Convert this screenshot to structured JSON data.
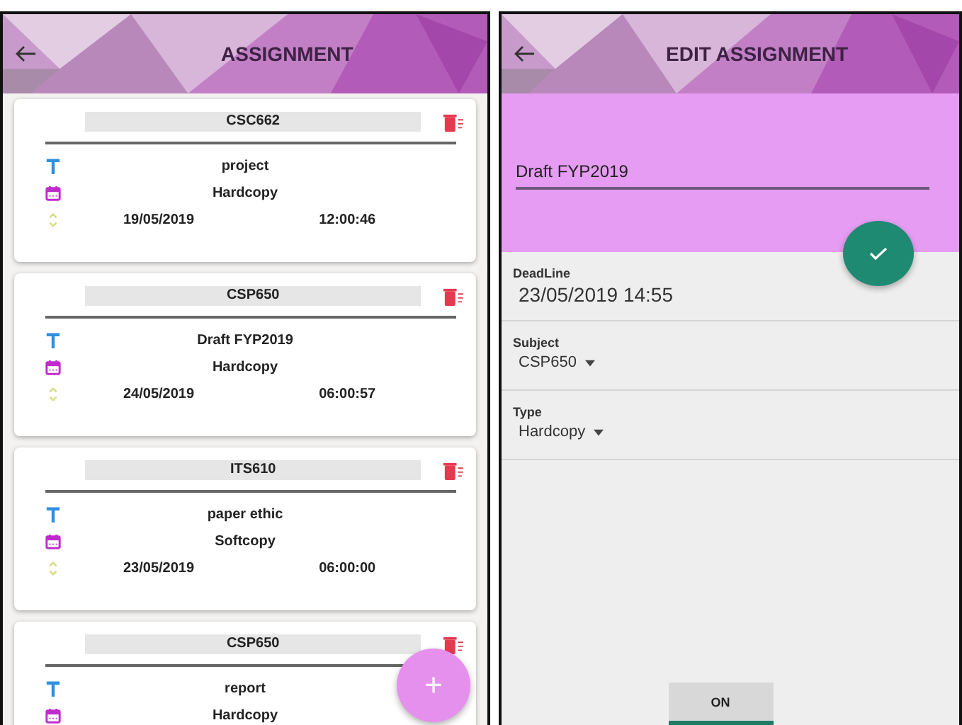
{
  "list_screen": {
    "title": "ASSIGNMENT",
    "cards": [
      {
        "subject": "CSC662",
        "name": "project",
        "type": "Hardcopy",
        "date": "19/05/2019",
        "time": "12:00:46"
      },
      {
        "subject": "CSP650",
        "name": "Draft FYP2019",
        "type": "Hardcopy",
        "date": "24/05/2019",
        "time": "06:00:57"
      },
      {
        "subject": "ITS610",
        "name": "paper ethic",
        "type": "Softcopy",
        "date": "23/05/2019",
        "time": "06:00:00"
      },
      {
        "subject": "CSP650",
        "name": "report",
        "type": "Hardcopy"
      }
    ],
    "add_button": "+"
  },
  "edit_screen": {
    "title": "EDIT ASSIGNMENT",
    "name_value": "Draft FYP2019",
    "fields": [
      {
        "kind": "text",
        "label": "DeadLine",
        "value": "23/05/2019 14:55"
      },
      {
        "kind": "dropdown",
        "label": "Subject",
        "value": "CSP650"
      },
      {
        "kind": "dropdown",
        "label": "Type",
        "value": "Hardcopy"
      }
    ],
    "toggle": {
      "label": "ON",
      "on": true
    }
  }
}
